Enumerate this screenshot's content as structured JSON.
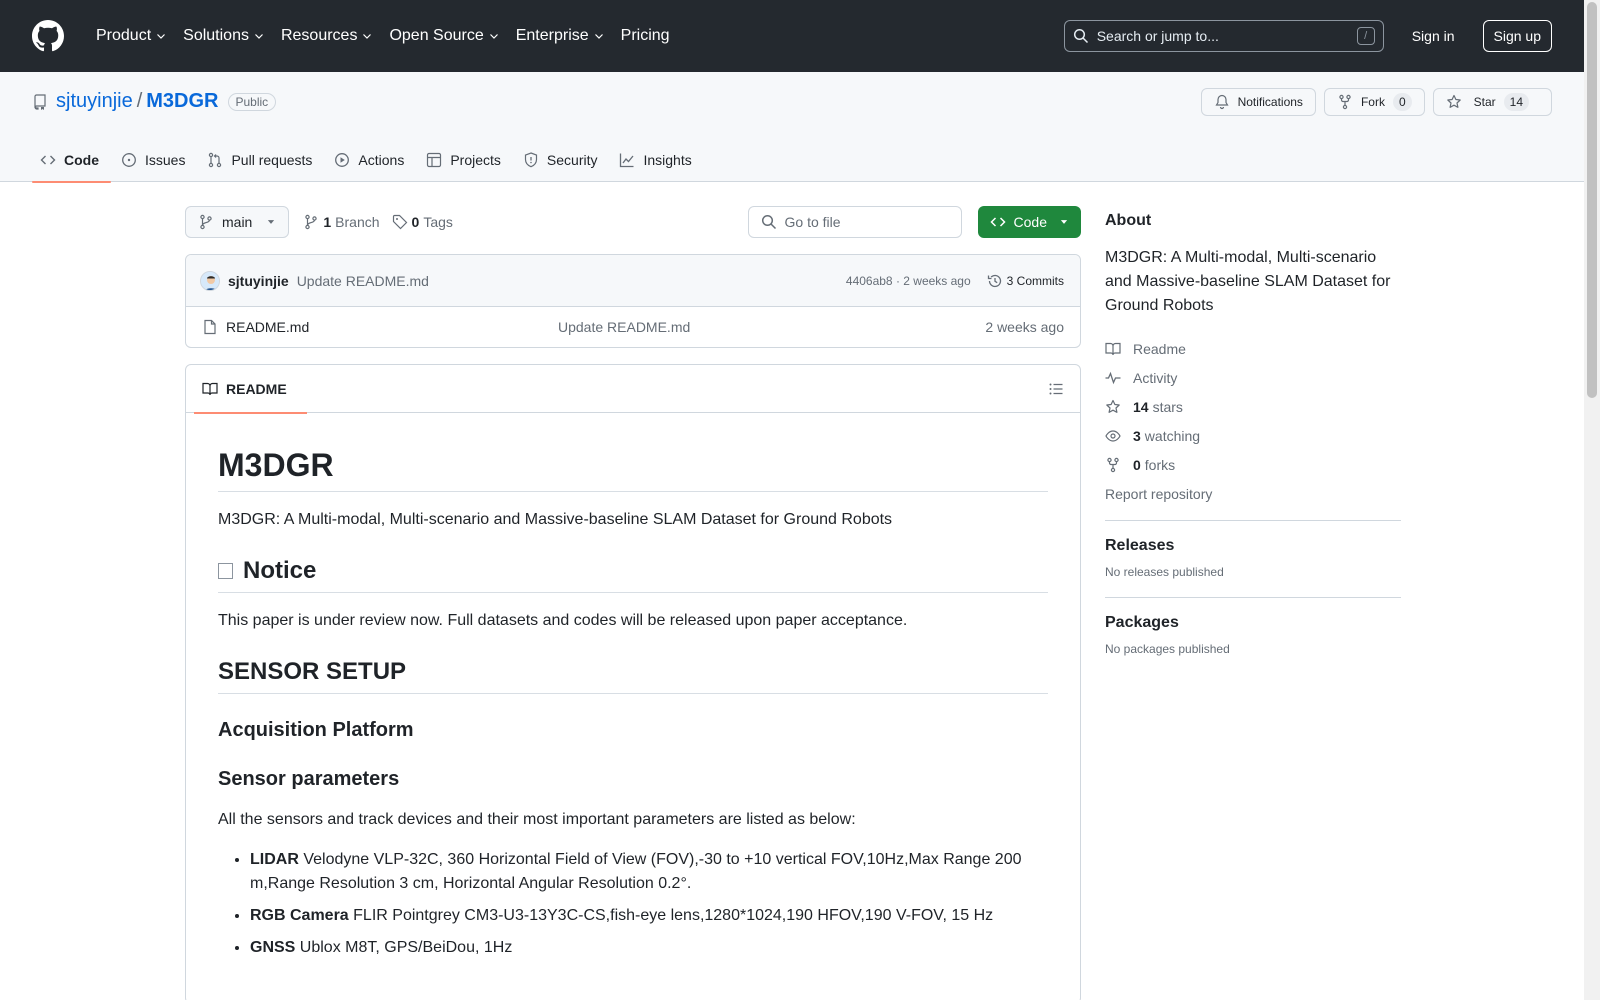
{
  "header": {
    "nav": [
      "Product",
      "Solutions",
      "Resources",
      "Open Source",
      "Enterprise",
      "Pricing"
    ],
    "search_placeholder": "Search or jump to...",
    "search_kbd": "/",
    "signin": "Sign in",
    "signup": "Sign up"
  },
  "repo": {
    "owner": "sjtuyinjie",
    "slash": "/",
    "name": "M3DGR",
    "visibility": "Public",
    "notifications": "Notifications",
    "fork_label": "Fork",
    "fork_count": "0",
    "star_label": "Star",
    "star_count": "14",
    "tabs": [
      "Code",
      "Issues",
      "Pull requests",
      "Actions",
      "Projects",
      "Security",
      "Insights"
    ]
  },
  "toolbar": {
    "branch": "main",
    "branch_count": "1",
    "branch_label": "Branch",
    "tag_count": "0",
    "tag_label": "Tags",
    "goto_placeholder": "Go to file",
    "code_label": "Code"
  },
  "commit": {
    "author": "sjtuyinjie",
    "message": "Update README.md",
    "meta": "4406ab8 · 2 weeks ago",
    "commits_label": "3 Commits"
  },
  "files": [
    {
      "name": "README.md",
      "commit": "Update README.md",
      "date": "2 weeks ago"
    }
  ],
  "readme": {
    "tab": "README",
    "h1": "M3DGR",
    "intro": "M3DGR: A Multi-modal, Multi-scenario and Massive-baseline SLAM Dataset for Ground Robots",
    "notice_heading": "Notice",
    "notice_text": "This paper is under review now. Full datasets and codes will be released upon paper acceptance.",
    "sensor_heading": "SENSOR SETUP",
    "platform_heading": "Acquisition Platform",
    "params_heading": "Sensor parameters",
    "params_intro": "All the sensors and track devices and their most important parameters are listed as below:",
    "sensors": [
      {
        "name": "LIDAR",
        "desc": " Velodyne VLP-32C, 360 Horizontal Field of View (FOV),-30 to +10 vertical FOV,10Hz,Max Range 200 m,Range Resolution 3 cm, Horizontal Angular Resolution 0.2°."
      },
      {
        "name": "RGB Camera",
        "desc": " FLIR Pointgrey CM3-U3-13Y3C-CS,fish-eye lens,1280*1024,190 HFOV,190 V-FOV, 15 Hz"
      },
      {
        "name": "GNSS",
        "desc": " Ublox M8T, GPS/BeiDou, 1Hz"
      }
    ]
  },
  "sidebar": {
    "about_heading": "About",
    "about_desc": "M3DGR: A Multi-modal, Multi-scenario and Massive-baseline SLAM Dataset for Ground Robots",
    "readme": "Readme",
    "activity": "Activity",
    "stars_count": "14",
    "stars_label": "stars",
    "watching_count": "3",
    "watching_label": "watching",
    "forks_count": "0",
    "forks_label": "forks",
    "report": "Report repository",
    "releases_heading": "Releases",
    "releases_empty": "No releases published",
    "packages_heading": "Packages",
    "packages_empty": "No packages published"
  },
  "colors": {
    "header_bg": "#24292f",
    "link": "#0969da",
    "code_button": "#1f883d",
    "active_tab_underline": "#fd8c73"
  }
}
